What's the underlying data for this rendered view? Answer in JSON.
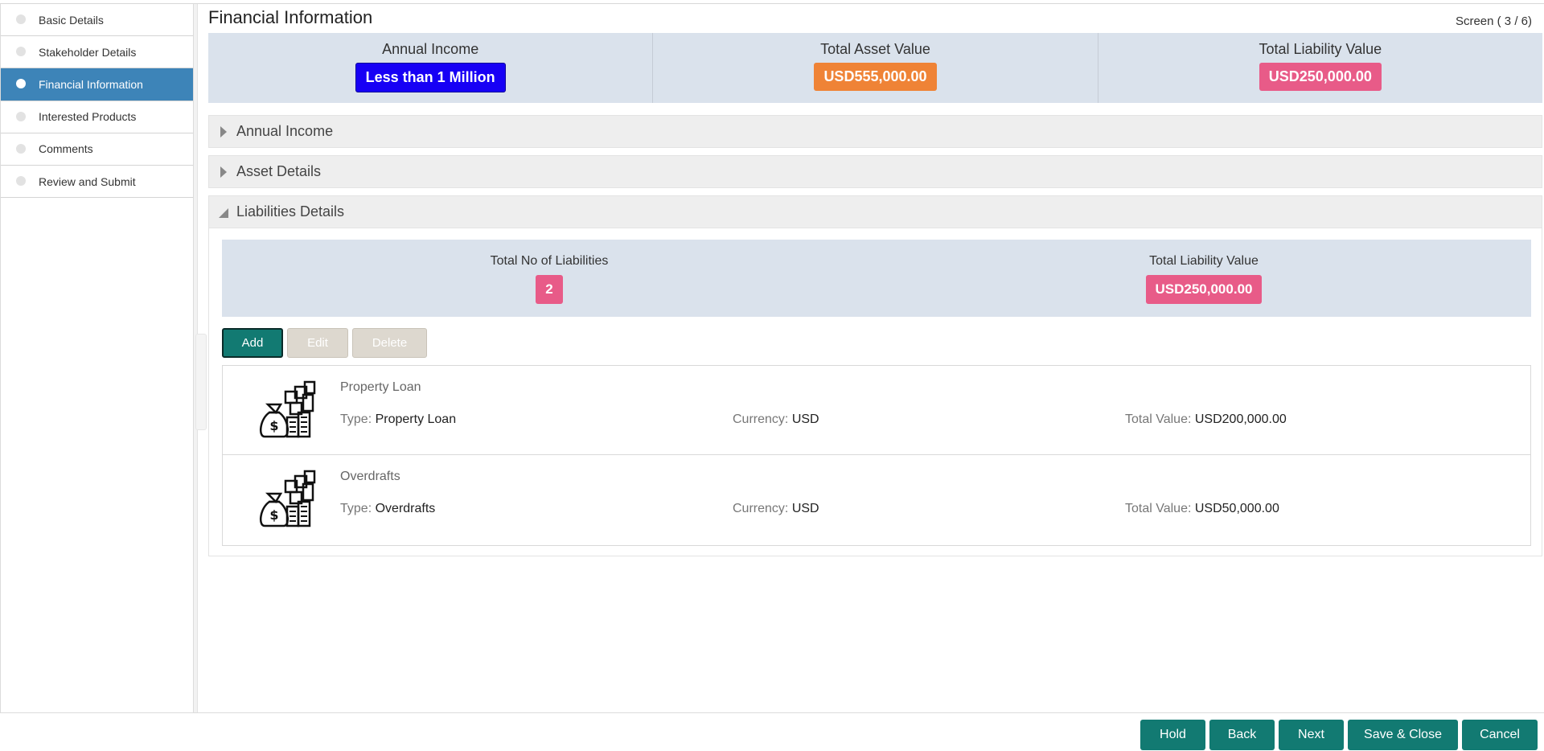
{
  "sidebar": {
    "items": [
      {
        "label": "Basic Details"
      },
      {
        "label": "Stakeholder Details"
      },
      {
        "label": "Financial Information"
      },
      {
        "label": "Interested Products"
      },
      {
        "label": "Comments"
      },
      {
        "label": "Review and Submit"
      }
    ],
    "active_index": 2
  },
  "header": {
    "title": "Financial Information",
    "screen_counter": "Screen ( 3 / 6)"
  },
  "summary": {
    "annual_income": {
      "label": "Annual Income",
      "value": "Less than 1 Million",
      "color": "#1700f5"
    },
    "total_asset": {
      "label": "Total Asset Value",
      "value": "USD555,000.00",
      "color": "#ef8336"
    },
    "total_liability": {
      "label": "Total Liability Value",
      "value": "USD250,000.00",
      "color": "#e85b88"
    }
  },
  "sections": {
    "annual_income": {
      "label": "Annual Income",
      "expanded": false
    },
    "asset_details": {
      "label": "Asset Details",
      "expanded": false
    },
    "liabilities_details": {
      "label": "Liabilities Details",
      "expanded": true
    }
  },
  "liabilities": {
    "count_label": "Total No of Liabilities",
    "count_value": "2",
    "total_label": "Total Liability Value",
    "total_value": "USD250,000.00",
    "buttons": {
      "add": "Add",
      "edit": "Edit",
      "delete": "Delete"
    },
    "items": [
      {
        "name": "Property Loan",
        "type_label": "Type:",
        "type_value": "Property Loan",
        "currency_label": "Currency:",
        "currency_value": "USD",
        "total_label": "Total Value:",
        "total_value": "USD200,000.00",
        "icon": "money-bag-stack-icon"
      },
      {
        "name": "Overdrafts",
        "type_label": "Type:",
        "type_value": "Overdrafts",
        "currency_label": "Currency:",
        "currency_value": "USD",
        "total_label": "Total Value:",
        "total_value": "USD50,000.00",
        "icon": "money-bag-stack-icon"
      }
    ]
  },
  "footer": {
    "hold": "Hold",
    "back": "Back",
    "next": "Next",
    "save_close": "Save & Close",
    "cancel": "Cancel"
  },
  "colors": {
    "accent": "#127a72",
    "sidebar_active": "#3d84b8",
    "summary_bg": "#dae2ec"
  }
}
